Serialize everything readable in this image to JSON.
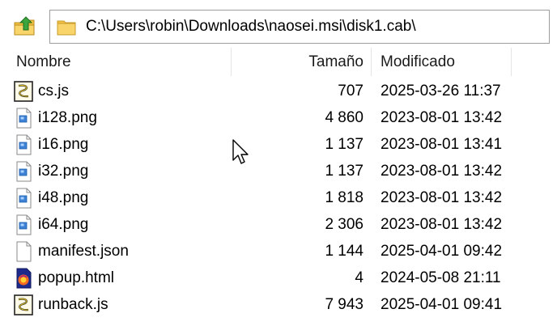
{
  "toolbar": {
    "up_icon": "folder-up-icon",
    "folder_icon": "folder-icon",
    "path": "C:\\Users\\robin\\Downloads\\naosei.msi\\disk1.cab\\"
  },
  "columns": {
    "name": "Nombre",
    "size": "Tamaño",
    "modified": "Modificado"
  },
  "files": [
    {
      "name": "cs.js",
      "size": "707",
      "modified": "2025-03-26 11:37",
      "icon": "script-file-icon"
    },
    {
      "name": "i128.png",
      "size": "4 860",
      "modified": "2023-08-01 13:42",
      "icon": "image-file-icon"
    },
    {
      "name": "i16.png",
      "size": "1 137",
      "modified": "2023-08-01 13:41",
      "icon": "image-file-icon"
    },
    {
      "name": "i32.png",
      "size": "1 137",
      "modified": "2023-08-01 13:42",
      "icon": "image-file-icon"
    },
    {
      "name": "i48.png",
      "size": "1 818",
      "modified": "2023-08-01 13:42",
      "icon": "image-file-icon"
    },
    {
      "name": "i64.png",
      "size": "2 306",
      "modified": "2023-08-01 13:42",
      "icon": "image-file-icon"
    },
    {
      "name": "manifest.json",
      "size": "1 144",
      "modified": "2025-04-01 09:42",
      "icon": "blank-file-icon"
    },
    {
      "name": "popup.html",
      "size": "4",
      "modified": "2024-05-08 21:11",
      "icon": "html-file-icon"
    },
    {
      "name": "runback.js",
      "size": "7 943",
      "modified": "2025-04-01 09:41",
      "icon": "script-file-icon"
    }
  ],
  "colors": {
    "header_separator": "#e5e5e5",
    "address_border": "#9d9d9d",
    "folder_yellow": "#f5c342",
    "up_arrow_green": "#3da53d"
  }
}
